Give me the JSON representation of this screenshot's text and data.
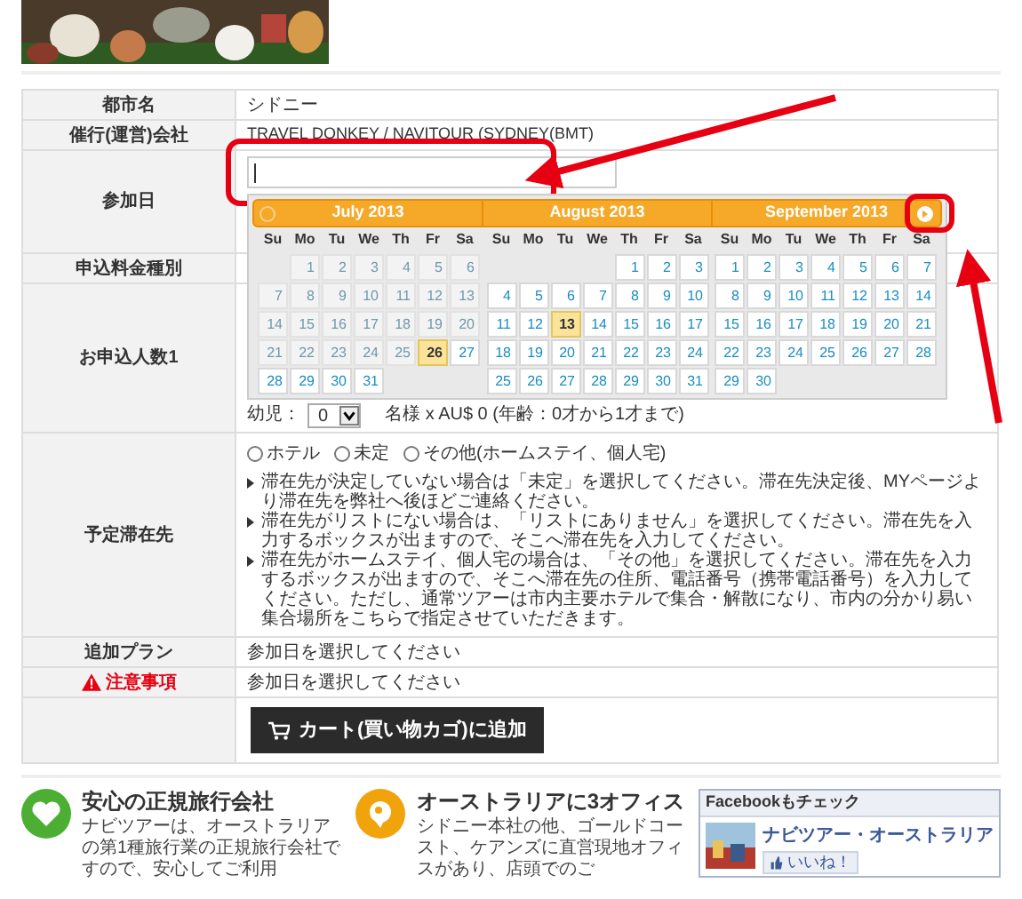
{
  "booking_table": {
    "rows": [
      {
        "kind": "text",
        "label": "都市名",
        "value": "シドニー"
      },
      {
        "kind": "text",
        "label": "催行(運営)会社",
        "value": "TRAVEL DONKEY / NAVITOUR (SYDNEY(BMT)"
      },
      {
        "kind": "date",
        "label": "参加日"
      },
      {
        "kind": "blank",
        "label": "申込料金種別"
      },
      {
        "kind": "count",
        "label": "お申込人数1",
        "field_label": "幼児：",
        "select_value": "0",
        "price_note": "名様 x AU$ 0 (年齢：0才から1才まで)"
      },
      {
        "kind": "stay",
        "label": "予定滞在先",
        "options": [
          {
            "label": "ホテル",
            "selected": false
          },
          {
            "label": "未定",
            "selected": false
          },
          {
            "label": "その他(ホームステイ、個人宅)",
            "selected": false
          }
        ],
        "notes": [
          "滞在先が決定していない場合は「未定」を選択してください。滞在先決定後、MYページより滞在先を弊社へ後ほどご連絡ください。",
          "滞在先がリストにない場合は、「リストにありません」を選択してください。滞在先を入力するボックスが出ますので、そこへ滞在先を入力してください。",
          "滞在先がホームステイ、個人宅の場合は、「その他」を選択してください。滞在先を入力するボックスが出ますので、そこへ滞在先の住所、電話番号（携帯電話番号）を入力してください。ただし、通常ツアーは市内主要ホテルで集合・解散になり、市内の分かり易い集合場所をこちらで指定させていただきます。"
        ]
      },
      {
        "kind": "text",
        "label": "追加プラン",
        "value": "参加日を選択してください"
      },
      {
        "kind": "warning",
        "label": "注意事項",
        "value": "参加日を選択してください"
      },
      {
        "kind": "button",
        "button_label": "カート(買い物カゴ)に追加"
      }
    ]
  },
  "datepicker": {
    "months": [
      {
        "title": "July 2013",
        "weekdays": [
          "Su",
          "Mo",
          "Tu",
          "We",
          "Th",
          "Fr",
          "Sa"
        ],
        "weeks": [
          [
            {
              "day": "1",
              "disabled": true,
              "highlighted": false
            },
            {
              "day": "2",
              "disabled": true,
              "highlighted": false
            },
            {
              "day": "3",
              "disabled": true,
              "highlighted": false
            },
            {
              "day": "4",
              "disabled": true,
              "highlighted": false
            },
            {
              "day": "5",
              "disabled": true,
              "highlighted": false
            },
            {
              "day": "6",
              "disabled": true,
              "highlighted": false
            }
          ],
          [
            {
              "day": "7",
              "disabled": true,
              "highlighted": false
            },
            {
              "day": "8",
              "disabled": true,
              "highlighted": false
            },
            {
              "day": "9",
              "disabled": true,
              "highlighted": false
            },
            {
              "day": "10",
              "disabled": true,
              "highlighted": false
            },
            {
              "day": "11",
              "disabled": true,
              "highlighted": false
            },
            {
              "day": "12",
              "disabled": true,
              "highlighted": false
            },
            {
              "day": "13",
              "disabled": true,
              "highlighted": false
            }
          ],
          [
            {
              "day": "14",
              "disabled": true,
              "highlighted": false
            },
            {
              "day": "15",
              "disabled": true,
              "highlighted": false
            },
            {
              "day": "16",
              "disabled": true,
              "highlighted": false
            },
            {
              "day": "17",
              "disabled": true,
              "highlighted": false
            },
            {
              "day": "18",
              "disabled": true,
              "highlighted": false
            },
            {
              "day": "19",
              "disabled": true,
              "highlighted": false
            },
            {
              "day": "20",
              "disabled": true,
              "highlighted": false
            }
          ],
          [
            {
              "day": "21",
              "disabled": true,
              "highlighted": false
            },
            {
              "day": "22",
              "disabled": true,
              "highlighted": false
            },
            {
              "day": "23",
              "disabled": true,
              "highlighted": false
            },
            {
              "day": "24",
              "disabled": true,
              "highlighted": false
            },
            {
              "day": "25",
              "disabled": true,
              "highlighted": false
            },
            {
              "day": "26",
              "disabled": false,
              "highlighted": true
            },
            {
              "day": "27",
              "disabled": false,
              "highlighted": false
            }
          ],
          [
            {
              "day": "28",
              "disabled": false,
              "highlighted": false
            },
            {
              "day": "29",
              "disabled": false,
              "highlighted": false
            },
            {
              "day": "30",
              "disabled": false,
              "highlighted": false
            },
            {
              "day": "31",
              "disabled": false,
              "highlighted": false
            }
          ]
        ]
      },
      {
        "title": "August 2013",
        "weekdays": [
          "Su",
          "Mo",
          "Tu",
          "We",
          "Th",
          "Fr",
          "Sa"
        ],
        "weeks": [
          [
            {
              "day": "1",
              "disabled": false,
              "highlighted": false
            },
            {
              "day": "2",
              "disabled": false,
              "highlighted": false
            },
            {
              "day": "3",
              "disabled": false,
              "highlighted": false
            }
          ],
          [
            {
              "day": "4",
              "disabled": false,
              "highlighted": false
            },
            {
              "day": "5",
              "disabled": false,
              "highlighted": false
            },
            {
              "day": "6",
              "disabled": false,
              "highlighted": false
            },
            {
              "day": "7",
              "disabled": false,
              "highlighted": false
            },
            {
              "day": "8",
              "disabled": false,
              "highlighted": false
            },
            {
              "day": "9",
              "disabled": false,
              "highlighted": false
            },
            {
              "day": "10",
              "disabled": false,
              "highlighted": false
            }
          ],
          [
            {
              "day": "11",
              "disabled": false,
              "highlighted": false
            },
            {
              "day": "12",
              "disabled": false,
              "highlighted": false
            },
            {
              "day": "13",
              "disabled": false,
              "highlighted": true
            },
            {
              "day": "14",
              "disabled": false,
              "highlighted": false
            },
            {
              "day": "15",
              "disabled": false,
              "highlighted": false
            },
            {
              "day": "16",
              "disabled": false,
              "highlighted": false
            },
            {
              "day": "17",
              "disabled": false,
              "highlighted": false
            }
          ],
          [
            {
              "day": "18",
              "disabled": false,
              "highlighted": false
            },
            {
              "day": "19",
              "disabled": false,
              "highlighted": false
            },
            {
              "day": "20",
              "disabled": false,
              "highlighted": false
            },
            {
              "day": "21",
              "disabled": false,
              "highlighted": false
            },
            {
              "day": "22",
              "disabled": false,
              "highlighted": false
            },
            {
              "day": "23",
              "disabled": false,
              "highlighted": false
            },
            {
              "day": "24",
              "disabled": false,
              "highlighted": false
            }
          ],
          [
            {
              "day": "25",
              "disabled": false,
              "highlighted": false
            },
            {
              "day": "26",
              "disabled": false,
              "highlighted": false
            },
            {
              "day": "27",
              "disabled": false,
              "highlighted": false
            },
            {
              "day": "28",
              "disabled": false,
              "highlighted": false
            },
            {
              "day": "29",
              "disabled": false,
              "highlighted": false
            },
            {
              "day": "30",
              "disabled": false,
              "highlighted": false
            },
            {
              "day": "31",
              "disabled": false,
              "highlighted": false
            }
          ]
        ]
      },
      {
        "title": "September 2013",
        "weekdays": [
          "Su",
          "Mo",
          "Tu",
          "We",
          "Th",
          "Fr",
          "Sa"
        ],
        "weeks": [
          [
            {
              "day": "1",
              "disabled": false,
              "highlighted": false
            },
            {
              "day": "2",
              "disabled": false,
              "highlighted": false
            },
            {
              "day": "3",
              "disabled": false,
              "highlighted": false
            },
            {
              "day": "4",
              "disabled": false,
              "highlighted": false
            },
            {
              "day": "5",
              "disabled": false,
              "highlighted": false
            },
            {
              "day": "6",
              "disabled": false,
              "highlighted": false
            },
            {
              "day": "7",
              "disabled": false,
              "highlighted": false
            }
          ],
          [
            {
              "day": "8",
              "disabled": false,
              "highlighted": false
            },
            {
              "day": "9",
              "disabled": false,
              "highlighted": false
            },
            {
              "day": "10",
              "disabled": false,
              "highlighted": false
            },
            {
              "day": "11",
              "disabled": false,
              "highlighted": false
            },
            {
              "day": "12",
              "disabled": false,
              "highlighted": false
            },
            {
              "day": "13",
              "disabled": false,
              "highlighted": false
            },
            {
              "day": "14",
              "disabled": false,
              "highlighted": false
            }
          ],
          [
            {
              "day": "15",
              "disabled": false,
              "highlighted": false
            },
            {
              "day": "16",
              "disabled": false,
              "highlighted": false
            },
            {
              "day": "17",
              "disabled": false,
              "highlighted": false
            },
            {
              "day": "18",
              "disabled": false,
              "highlighted": false
            },
            {
              "day": "19",
              "disabled": false,
              "highlighted": false
            },
            {
              "day": "20",
              "disabled": false,
              "highlighted": false
            },
            {
              "day": "21",
              "disabled": false,
              "highlighted": false
            }
          ],
          [
            {
              "day": "22",
              "disabled": false,
              "highlighted": false
            },
            {
              "day": "23",
              "disabled": false,
              "highlighted": false
            },
            {
              "day": "24",
              "disabled": false,
              "highlighted": false
            },
            {
              "day": "25",
              "disabled": false,
              "highlighted": false
            },
            {
              "day": "26",
              "disabled": false,
              "highlighted": false
            },
            {
              "day": "27",
              "disabled": false,
              "highlighted": false
            },
            {
              "day": "28",
              "disabled": false,
              "highlighted": false
            }
          ],
          [
            {
              "day": "29",
              "disabled": false,
              "highlighted": false
            },
            {
              "day": "30",
              "disabled": false,
              "highlighted": false
            }
          ]
        ]
      }
    ]
  },
  "features": [
    {
      "kind": "heart",
      "title": "安心の正規旅行会社",
      "text": "ナビツアーは、オーストラリアの第1種旅行業の正規旅行会社ですので、安心してご利用"
    },
    {
      "kind": "office",
      "title": "オーストラリアに3オフィス",
      "text": "シドニー本社の他、ゴールドコースト、ケアンズに直営現地オフィスがあり、店頭でのご"
    }
  ],
  "facebook_box": {
    "title": "Facebookもチェック",
    "page_name": "ナビツアー・オーストラリア",
    "like_label": "いいね！"
  }
}
